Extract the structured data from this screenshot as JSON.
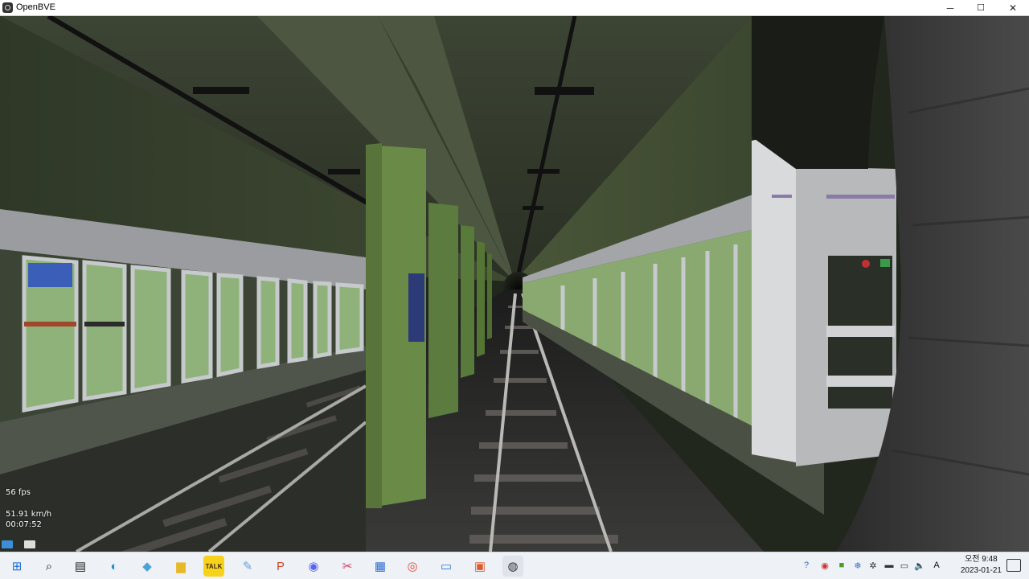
{
  "window": {
    "title": "OpenBVE",
    "minimize": "─",
    "maximize": "☐",
    "close": "✕"
  },
  "hud": {
    "fps": "56 fps",
    "speed": "51.91 km/h",
    "time": "00:07:52"
  },
  "scene": {
    "description_icon": "train-cab-view-icon"
  },
  "taskbar": {
    "icons": [
      {
        "name": "start-icon",
        "glyph": "⊞",
        "color": "#1e6fd9"
      },
      {
        "name": "search-icon",
        "glyph": "⌕",
        "color": "#222"
      },
      {
        "name": "task-view-icon",
        "glyph": "▤",
        "color": "#222"
      },
      {
        "name": "edge-icon",
        "glyph": "◐",
        "color": "#1b8fd6"
      },
      {
        "name": "app-icon",
        "glyph": "◆",
        "color": "#4aa3d6"
      },
      {
        "name": "file-explorer-icon",
        "glyph": "▆",
        "color": "#e7b928"
      },
      {
        "name": "kakaotalk-icon",
        "glyph": "TALK",
        "color": "#3b2a10"
      },
      {
        "name": "paint-icon",
        "glyph": "✎",
        "color": "#6aa0d8"
      },
      {
        "name": "powerpoint-icon",
        "glyph": "P",
        "color": "#d24726"
      },
      {
        "name": "discord-icon",
        "glyph": "◉",
        "color": "#5865f2"
      },
      {
        "name": "tool-icon",
        "glyph": "✂",
        "color": "#d04060"
      },
      {
        "name": "calculator-icon",
        "glyph": "▦",
        "color": "#2d6ecf"
      },
      {
        "name": "chrome-icon",
        "glyph": "◎",
        "color": "#dd4b39"
      },
      {
        "name": "remote-desktop-icon",
        "glyph": "▭",
        "color": "#2b7bd0"
      },
      {
        "name": "image-viewer-icon",
        "glyph": "▣",
        "color": "#e05a2a"
      },
      {
        "name": "openbve-icon",
        "glyph": "◍",
        "color": "#333"
      }
    ],
    "tray": [
      {
        "name": "help-icon",
        "glyph": "?",
        "color": "#1e6fd9"
      },
      {
        "name": "record-icon",
        "glyph": "◉",
        "color": "#d03030"
      },
      {
        "name": "nvidia-icon",
        "glyph": "■",
        "color": "#4c9a2a"
      },
      {
        "name": "snowflake-icon",
        "glyph": "❄",
        "color": "#2d6ecf"
      },
      {
        "name": "tray-app-icon",
        "glyph": "✲",
        "color": "#333"
      },
      {
        "name": "battery-icon",
        "glyph": "▬",
        "color": "#333"
      },
      {
        "name": "network-icon",
        "glyph": "▭",
        "color": "#333"
      },
      {
        "name": "volume-icon",
        "glyph": "🔈",
        "color": "#333"
      },
      {
        "name": "input-method-icon",
        "glyph": "A",
        "color": "#111"
      }
    ],
    "clock_time": "오전 9:48",
    "clock_date": "2023-01-21"
  }
}
